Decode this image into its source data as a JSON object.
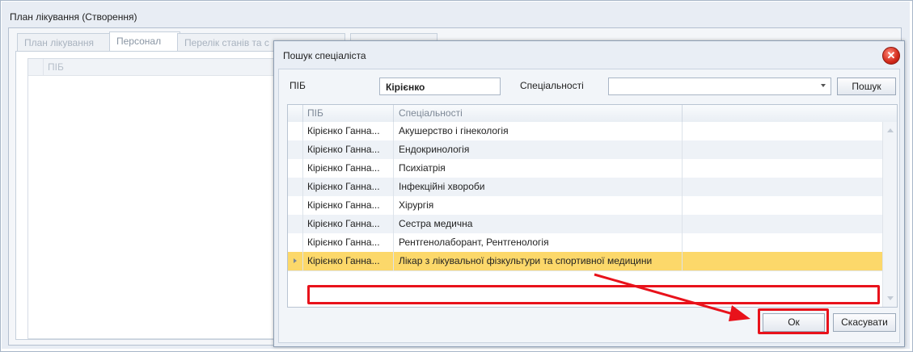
{
  "main_window": {
    "title": "План лікування (Створення)",
    "tabs": [
      {
        "label": "План лікування"
      },
      {
        "label": "Персонал"
      },
      {
        "label": "Перелік станів та с"
      },
      {
        "label": ""
      }
    ],
    "staff_grid": {
      "header": "ПІБ"
    }
  },
  "dialog": {
    "title": "Пошук спеціаліста",
    "close_icon": "✕",
    "name_label": "ПІБ",
    "name_value": "Кірієнко",
    "spec_label": "Спеціальності",
    "spec_value": "",
    "search_button": "Пошук",
    "columns": [
      "ПІБ",
      "Спеціальності"
    ],
    "rows": [
      {
        "name": "Кірієнко Ганна...",
        "specialty": "Акушерство і гінекологія"
      },
      {
        "name": "Кірієнко Ганна...",
        "specialty": "Ендокринологія"
      },
      {
        "name": "Кірієнко Ганна...",
        "specialty": "Психіатрія"
      },
      {
        "name": "Кірієнко Ганна...",
        "specialty": "Інфекційні хвороби"
      },
      {
        "name": "Кірієнко Ганна...",
        "specialty": "Хірургія"
      },
      {
        "name": "Кірієнко Ганна...",
        "specialty": "Сестра медична"
      },
      {
        "name": "Кірієнко Ганна...",
        "specialty": "Рентгенолаборант, Рентгенологія"
      },
      {
        "name": "Кірієнко Ганна...",
        "specialty": "Лікар з лікувальної фізкультури та спортивної медицини"
      }
    ],
    "selected_row": 7,
    "ok_button": "Ок",
    "cancel_button": "Скасувати"
  },
  "colors": {
    "highlight": "#e8121b",
    "selected_row": "#fcd86a",
    "alt_row": "#eef2f7"
  }
}
